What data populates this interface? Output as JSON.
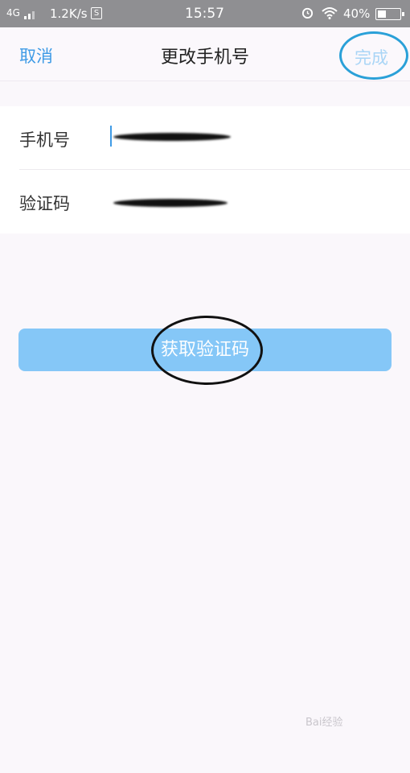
{
  "status_bar": {
    "network": "4G",
    "speed": "1.2K/s",
    "s_badge": "S",
    "time": "15:57",
    "battery": "40%",
    "icons": [
      "signal-icon",
      "alarm-icon",
      "wifi-icon",
      "battery-icon"
    ]
  },
  "nav": {
    "cancel_label": "取消",
    "title": "更改手机号",
    "done_label": "完成"
  },
  "form": {
    "phone_label": "手机号",
    "code_label": "验证码"
  },
  "get_code_label": "获取验证码",
  "colors": {
    "accent": "#3f9be6",
    "button": "#85c7f7",
    "done_disabled": "#a9d5f6",
    "annotation_blue": "#2aa0d8",
    "annotation_black": "#111111"
  },
  "watermark": "Bai经验"
}
